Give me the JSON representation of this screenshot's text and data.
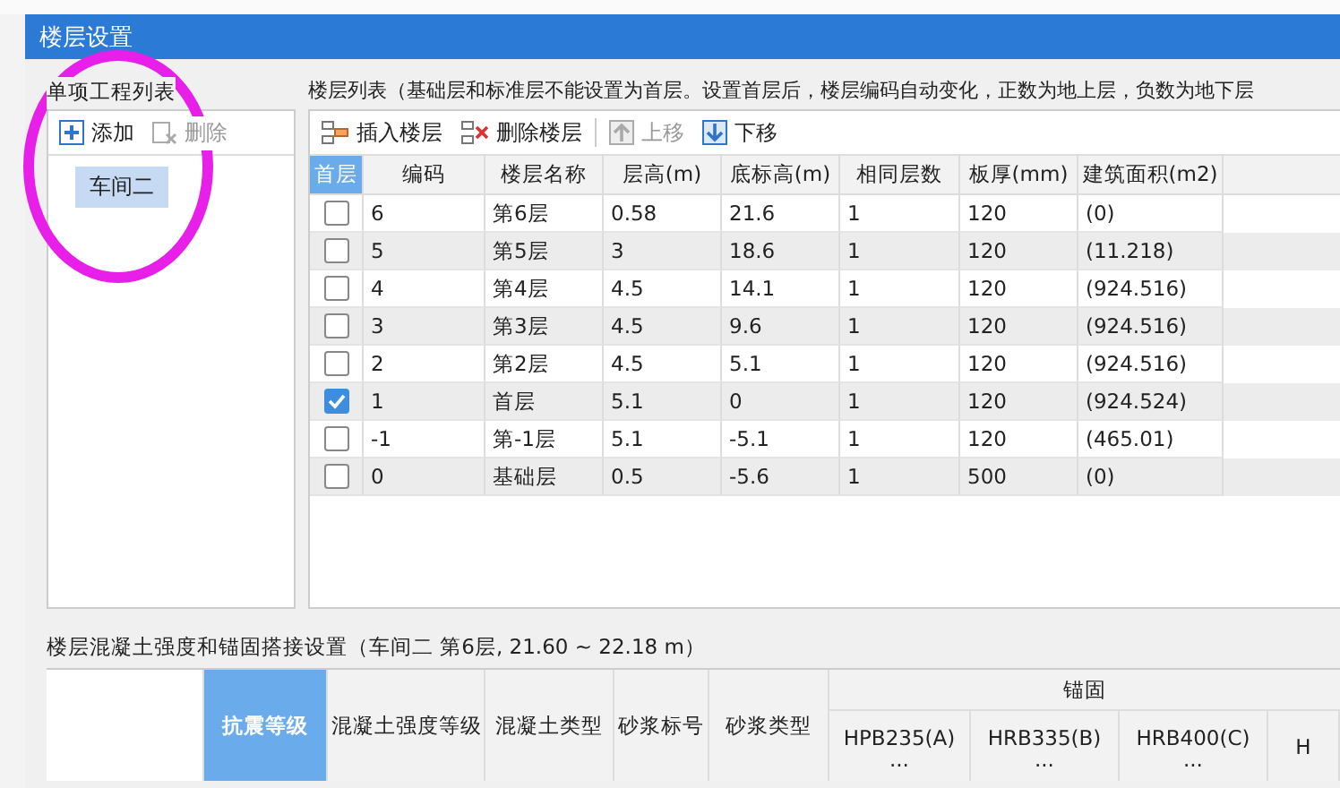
{
  "window": {
    "title": "楼层设置"
  },
  "projects": {
    "title": "单项工程列表",
    "toolbar": [
      {
        "kind": "add",
        "label": "添加",
        "disabled": false
      },
      {
        "kind": "delete",
        "label": "删除",
        "disabled": true
      }
    ],
    "items": [
      {
        "label": "车间二",
        "selected": true
      }
    ]
  },
  "floors": {
    "title": "楼层列表（基础层和标准层不能设置为首层。设置首层后，楼层编码自动变化，正数为地上层，负数为地下层",
    "toolbar": [
      {
        "kind": "insert",
        "label": "插入楼层",
        "disabled": false
      },
      {
        "kind": "remove",
        "label": "删除楼层",
        "disabled": false
      },
      {
        "kind": "up",
        "label": "上移",
        "disabled": true
      },
      {
        "kind": "down",
        "label": "下移",
        "disabled": false
      }
    ],
    "check_column": "首层",
    "columns": [
      "编码",
      "楼层名称",
      "层高(m)",
      "底标高(m)",
      "相同层数",
      "板厚(mm)",
      "建筑面积(m2)"
    ],
    "rows": [
      {
        "first": false,
        "cells": [
          "6",
          "第6层",
          "0.58",
          "21.6",
          "1",
          "120",
          "(0)"
        ]
      },
      {
        "first": false,
        "cells": [
          "5",
          "第5层",
          "3",
          "18.6",
          "1",
          "120",
          "(11.218)"
        ]
      },
      {
        "first": false,
        "cells": [
          "4",
          "第4层",
          "4.5",
          "14.1",
          "1",
          "120",
          "(924.516)"
        ]
      },
      {
        "first": false,
        "cells": [
          "3",
          "第3层",
          "4.5",
          "9.6",
          "1",
          "120",
          "(924.516)"
        ]
      },
      {
        "first": false,
        "cells": [
          "2",
          "第2层",
          "4.5",
          "5.1",
          "1",
          "120",
          "(924.516)"
        ]
      },
      {
        "first": true,
        "cells": [
          "1",
          "首层",
          "5.1",
          "0",
          "1",
          "120",
          "(924.524)"
        ]
      },
      {
        "first": false,
        "cells": [
          "-1",
          "第-1层",
          "5.1",
          "-5.1",
          "1",
          "120",
          "(465.01)"
        ]
      },
      {
        "first": false,
        "cells": [
          "0",
          "基础层",
          "0.5",
          "-5.6",
          "1",
          "500",
          "(0)"
        ]
      }
    ]
  },
  "concrete": {
    "title": "楼层混凝土强度和锚固搭接设置（车间二  第6层, 21.60 ~ 22.18 m）",
    "columns": [
      "抗震等级",
      "混凝土强度等级",
      "混凝土类型",
      "砂浆标号",
      "砂浆类型"
    ],
    "group": "锚固",
    "sub_columns": [
      {
        "label": "HPB235(A)",
        "more": "..."
      },
      {
        "label": "HRB335(B)",
        "more": "..."
      },
      {
        "label": "HRB400(C)",
        "more": "..."
      },
      {
        "label": "H"
      }
    ]
  }
}
